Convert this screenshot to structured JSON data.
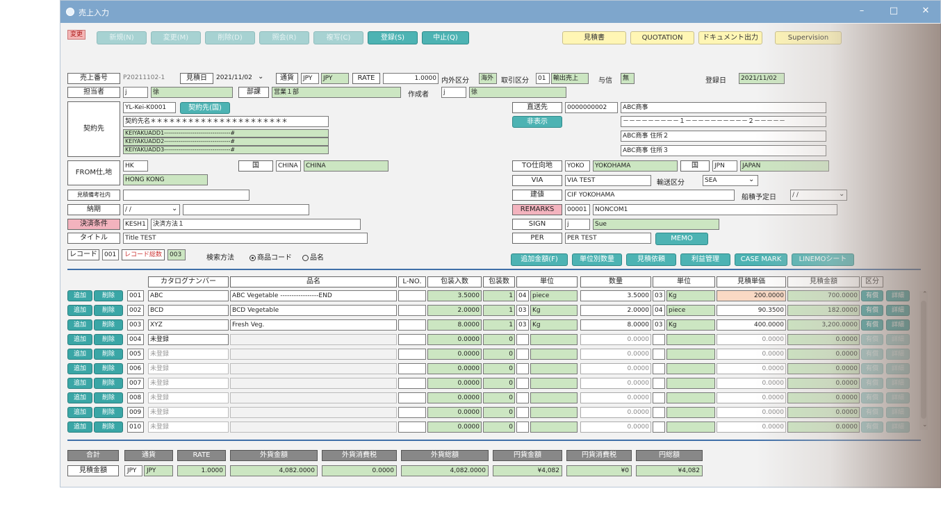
{
  "window": {
    "title": "売上入力",
    "minimize": "–",
    "maximize": "□",
    "close": "✕"
  },
  "toolbar": {
    "status_tag": "変更",
    "buttons": [
      "新規(N)",
      "変更(M)",
      "削除(D)",
      "照会(R)",
      "複写(C)",
      "登録(S)",
      "中止(Q)"
    ],
    "right_buttons": [
      "見積書",
      "QUOTATION",
      "ドキュメント出力",
      "Supervision"
    ]
  },
  "header": {
    "sales_no_label": "売上番号",
    "sales_no": "P20211102-1",
    "quote_date_label": "見積日",
    "quote_date": "2021/11/02",
    "currency_label": "通貨",
    "currency_code": "JPY",
    "currency_name": "JPY",
    "rate_label": "RATE",
    "rate": "1.0000",
    "domestic_label": "内外区分",
    "domestic": "海外",
    "trade_label": "取引区分",
    "trade_code": "01",
    "trade_name": "輸出売上",
    "credit_label": "与信",
    "credit": "無",
    "reg_date_label": "登録日",
    "reg_date": "2021/11/02",
    "staff_label": "担当者",
    "staff_code": "j",
    "staff_name": "徐",
    "dept_label": "部課",
    "dept": "営業１部",
    "creator_label": "作成者",
    "creator_code": "j",
    "creator_name": "徐"
  },
  "customer": {
    "label": "契約先",
    "code": "YL-Kei-K0001",
    "button": "契約先(国)",
    "name": "契約先名＊＊＊＊＊＊＊＊＊＊＊＊＊＊＊＊＊＊＊＊＊＊",
    "addr1": "KEIYAKUADD1---------------------------------#",
    "addr2": "KEIYAKUADD2---------------------------------#",
    "addr3": "KEIYAKUADD3---------------------------------#",
    "ship_label": "直送先",
    "ship_code": "0000000002",
    "ship_name": "ABC商事",
    "ship_button": "非表示",
    "ship_line1": "－－－－－－－－－１－－－－－－－－－－２－－－－－",
    "ship_addr2": "ABC商事 住所２",
    "ship_addr3": "ABC商事 住所３"
  },
  "ports": {
    "from_label": "FROM仕,地",
    "from_code": "HK",
    "from_name": "HONG KONG",
    "country_label": "国",
    "from_country_code": "CHINA",
    "from_country_name": "CHINA",
    "to_label": "TO仕向地",
    "to_code": "YOKO",
    "to_name": "YOKOHAMA",
    "to_country_code": "JPN",
    "to_country_name": "JAPAN",
    "via_label": "VIA",
    "via": "VIA TEST",
    "transport_label": "輸送区分",
    "transport": "SEA",
    "orig_label": "見積備考社内",
    "terms_label": "建値",
    "terms": "CIF YOKOHAMA",
    "ship_date_label": "船積予定日",
    "ship_date": " / /",
    "delivery_label": "納期",
    "delivery": " / /",
    "remarks_label": "REMARKS",
    "remarks_code": "00001",
    "remarks_name": "NONCOM1",
    "payment_label": "決済条件",
    "payment_code": "KESH1",
    "payment_name": "決済方法１",
    "sign_label": "SIGN",
    "sign_code": "j",
    "sign_name": "Sue",
    "title_label": "タイトル",
    "title_value": "Title TEST",
    "per_label": "PER",
    "per": "PER TEST",
    "memo_button": "MEMO",
    "record_label": "レコード",
    "record_value": "001",
    "record_count_label": "レコード総数",
    "record_count": "003",
    "search_label": "検索方法",
    "search_opt1": "商品コード",
    "search_opt2": "品名"
  },
  "action_buttons": [
    "追加金額(F)",
    "単位別数量",
    "見積依頼",
    "利益管理",
    "CASE MARK",
    "LINEMOシート"
  ],
  "table": {
    "headers": [
      "カタログナンバー",
      "品名",
      "L-NO.",
      "包装入数",
      "包装数",
      "単位",
      "数量",
      "単位",
      "見積単価",
      "見積金額",
      "区分"
    ],
    "add": "追加",
    "del": "削除",
    "tax": "有償",
    "detail": "詳細",
    "rows": [
      {
        "no": "001",
        "cat": "ABC",
        "name": "ABC Vegetable -----------------END",
        "pack": "3.5000",
        "pkgs": "1",
        "u1c": "04",
        "u1": "piece",
        "qty": "3.5000",
        "u2c": "03",
        "u2": "Kg",
        "price": "200.0000",
        "amt": "700.0000",
        "active": true
      },
      {
        "no": "002",
        "cat": "BCD",
        "name": "BCD Vegetable",
        "pack": "2.0000",
        "pkgs": "1",
        "u1c": "03",
        "u1": "Kg",
        "qty": "2.0000",
        "u2c": "04",
        "u2": "piece",
        "price": "90.3500",
        "amt": "182.0000",
        "active": true
      },
      {
        "no": "003",
        "cat": "XYZ",
        "name": "Fresh Veg.",
        "pack": "8.0000",
        "pkgs": "1",
        "u1c": "03",
        "u1": "Kg",
        "qty": "8.0000",
        "u2c": "03",
        "u2": "Kg",
        "price": "400.0000",
        "amt": "3,200.0000",
        "active": true
      },
      {
        "no": "004",
        "cat": "未登録",
        "name": "",
        "pack": "0.0000",
        "pkgs": "0",
        "u1c": "",
        "u1": "",
        "qty": "0.0000",
        "u2c": "",
        "u2": "",
        "price": "0.0000",
        "amt": "0.0000",
        "active": false,
        "editing": true
      },
      {
        "no": "005",
        "cat": "未登録",
        "name": "",
        "pack": "0.0000",
        "pkgs": "0",
        "u1c": "",
        "u1": "",
        "qty": "0.0000",
        "u2c": "",
        "u2": "",
        "price": "0.0000",
        "amt": "0.0000",
        "active": false
      },
      {
        "no": "006",
        "cat": "未登録",
        "name": "",
        "pack": "0.0000",
        "pkgs": "0",
        "u1c": "",
        "u1": "",
        "qty": "0.0000",
        "u2c": "",
        "u2": "",
        "price": "0.0000",
        "amt": "0.0000",
        "active": false
      },
      {
        "no": "007",
        "cat": "未登録",
        "name": "",
        "pack": "0.0000",
        "pkgs": "0",
        "u1c": "",
        "u1": "",
        "qty": "0.0000",
        "u2c": "",
        "u2": "",
        "price": "0.0000",
        "amt": "0.0000",
        "active": false
      },
      {
        "no": "008",
        "cat": "未登録",
        "name": "",
        "pack": "0.0000",
        "pkgs": "0",
        "u1c": "",
        "u1": "",
        "qty": "0.0000",
        "u2c": "",
        "u2": "",
        "price": "0.0000",
        "amt": "0.0000",
        "active": false
      },
      {
        "no": "009",
        "cat": "未登録",
        "name": "",
        "pack": "0.0000",
        "pkgs": "0",
        "u1c": "",
        "u1": "",
        "qty": "0.0000",
        "u2c": "",
        "u2": "",
        "price": "0.0000",
        "amt": "0.0000",
        "active": false
      },
      {
        "no": "010",
        "cat": "未登録",
        "name": "",
        "pack": "0.0000",
        "pkgs": "0",
        "u1c": "",
        "u1": "",
        "qty": "0.0000",
        "u2c": "",
        "u2": "",
        "price": "0.0000",
        "amt": "0.0000",
        "active": false
      }
    ]
  },
  "summary": {
    "headers": [
      "合計",
      "通貨",
      "RATE",
      "外貨金額",
      "外貨消費税",
      "外貨総額",
      "円貨金額",
      "円貨消費税",
      "円総額"
    ],
    "row_label": "見積金額",
    "currency_code": "JPY",
    "currency_name": "JPY",
    "rate": "1.0000",
    "fx_amount": "4,082.0000",
    "fx_tax": "0.0000",
    "fx_total": "4,082.0000",
    "jpy_amount": "¥4,082",
    "jpy_tax": "¥0",
    "jpy_total": "¥4,082"
  }
}
